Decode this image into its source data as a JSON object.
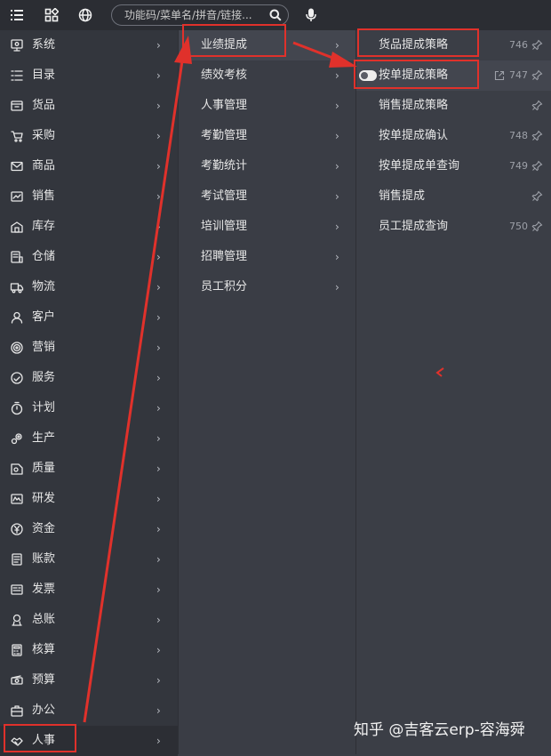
{
  "search": {
    "placeholder": "功能码/菜单名/拼音/链接..."
  },
  "main_menu": [
    {
      "label": "系统",
      "icon": "monitor-icon"
    },
    {
      "label": "目录",
      "icon": "list-icon"
    },
    {
      "label": "货品",
      "icon": "box-icon"
    },
    {
      "label": "采购",
      "icon": "cart-icon"
    },
    {
      "label": "商品",
      "icon": "envelope-icon"
    },
    {
      "label": "销售",
      "icon": "sales-icon"
    },
    {
      "label": "库存",
      "icon": "warehouse-icon"
    },
    {
      "label": "仓储",
      "icon": "storage-icon"
    },
    {
      "label": "物流",
      "icon": "truck-icon"
    },
    {
      "label": "客户",
      "icon": "user-icon"
    },
    {
      "label": "营销",
      "icon": "target-icon"
    },
    {
      "label": "服务",
      "icon": "service-icon"
    },
    {
      "label": "计划",
      "icon": "timer-icon"
    },
    {
      "label": "生产",
      "icon": "gears-icon"
    },
    {
      "label": "质量",
      "icon": "quality-icon"
    },
    {
      "label": "研发",
      "icon": "rnd-icon"
    },
    {
      "label": "资金",
      "icon": "yen-icon"
    },
    {
      "label": "账款",
      "icon": "ledger-icon"
    },
    {
      "label": "发票",
      "icon": "invoice-icon"
    },
    {
      "label": "总账",
      "icon": "account-book-icon"
    },
    {
      "label": "核算",
      "icon": "calculator-icon"
    },
    {
      "label": "预算",
      "icon": "cash-icon"
    },
    {
      "label": "办公",
      "icon": "briefcase-icon"
    },
    {
      "label": "人事",
      "icon": "handshake-icon",
      "active": true
    }
  ],
  "sub_menu": [
    {
      "label": "业绩提成",
      "active": true
    },
    {
      "label": "绩效考核"
    },
    {
      "label": "人事管理"
    },
    {
      "label": "考勤管理"
    },
    {
      "label": "考勤统计"
    },
    {
      "label": "考试管理"
    },
    {
      "label": "培训管理"
    },
    {
      "label": "招聘管理"
    },
    {
      "label": "员工积分"
    }
  ],
  "leaf_menu": [
    {
      "label": "货品提成策略",
      "code": "746"
    },
    {
      "label": "按单提成策略",
      "code": "747",
      "active": true
    },
    {
      "label": "销售提成策略",
      "code": ""
    },
    {
      "label": "按单提成确认",
      "code": "748"
    },
    {
      "label": "按单提成单查询",
      "code": "749"
    },
    {
      "label": "销售提成",
      "code": ""
    },
    {
      "label": "员工提成查询",
      "code": "750"
    }
  ],
  "watermark": "知乎 @吉客云erp-容海舜",
  "colors": {
    "annotation": "#e0312b",
    "menu_bg": "#33363d",
    "topbar_bg": "#2b2d33"
  }
}
